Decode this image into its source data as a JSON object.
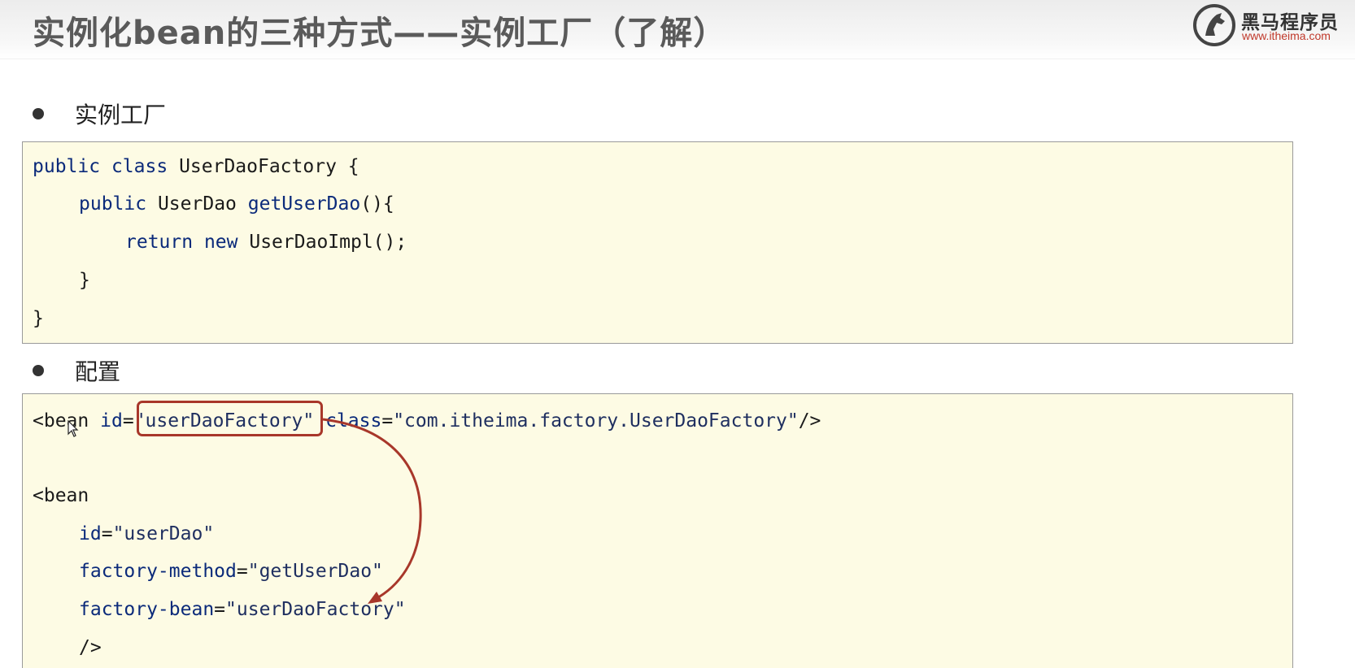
{
  "header": {
    "title": "实例化bean的三种方式——实例工厂（了解）",
    "logo_name": "黑马程序员",
    "logo_url": "www.itheima.com"
  },
  "sections": [
    {
      "label": "实例工厂"
    },
    {
      "label": "配置"
    }
  ],
  "java_code": {
    "l1": {
      "kw1": "public",
      "kw2": "class",
      "rest": "UserDaoFactory {"
    },
    "l2": {
      "kw1": "public",
      "type": "UserDao",
      "method": "getUserDao",
      "rest": "(){"
    },
    "l3": {
      "kw1": "return",
      "kw2": "new",
      "rest": "UserDaoImpl();"
    },
    "l4": {
      "rest": "}"
    },
    "l5": {
      "rest": "}"
    }
  },
  "xml_code": {
    "l1": {
      "open": "<bean",
      "attr1": "id",
      "val1": "\"userDaoFactory\"",
      "attr2": "class",
      "val2": "\"com.itheima.factory.UserDaoFactory\"",
      "close": "/>"
    },
    "l2": {
      "open": "<bean"
    },
    "l3": {
      "attr": "id",
      "val": "\"userDao\""
    },
    "l4": {
      "attr": "factory-method",
      "val": "\"getUserDao\""
    },
    "l5": {
      "attr": "factory-bean",
      "val": "\"userDaoFactory\""
    },
    "l6": {
      "close": "/>"
    }
  },
  "colors": {
    "code_background": "#fdfbe4",
    "keyword": "#0b2a7a",
    "highlight": "#a8372a"
  }
}
